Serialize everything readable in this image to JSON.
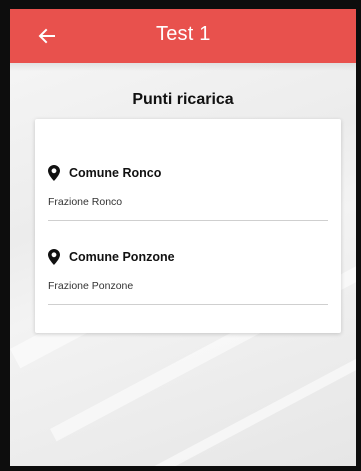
{
  "appbar": {
    "title": "Test 1",
    "back_icon": "arrow-left-icon",
    "color": "#e8514d"
  },
  "heading": "Punti ricarica",
  "locations": [
    {
      "name": "Comune Ronco",
      "subtitle": "Frazione Ronco",
      "icon": "map-pin-icon"
    },
    {
      "name": "Comune Ponzone",
      "subtitle": "Frazione Ponzone",
      "icon": "map-pin-icon"
    }
  ]
}
